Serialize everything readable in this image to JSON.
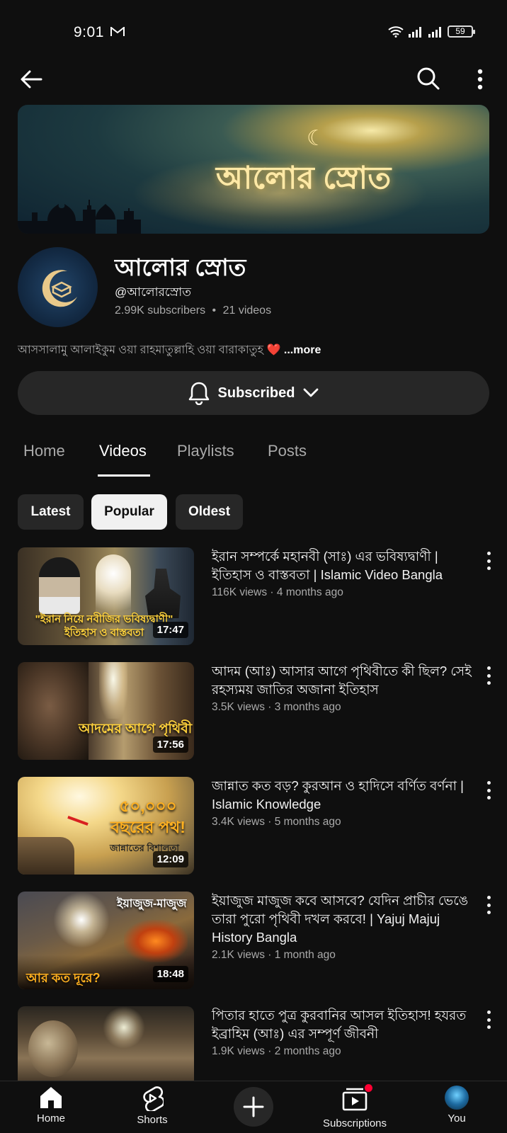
{
  "status_bar": {
    "time": "9:01",
    "battery": "59"
  },
  "channel": {
    "banner_title": "আলোর স্রোত",
    "name": "আলোর স্রোত",
    "handle": "@আলোরস্রোত",
    "subscribers": "2.99K subscribers",
    "videos_count": "21 videos",
    "meta_separator": "•",
    "description": "আসসালামু আলাইকুম ওয়া রাহমাতুল্লাহি ওয়া বারাকাতুহ",
    "description_emoji": "❤️",
    "more_label": "...more",
    "subscribe_label": "Subscribed"
  },
  "tabs": [
    {
      "label": "Home"
    },
    {
      "label": "Videos"
    },
    {
      "label": "Playlists"
    },
    {
      "label": "Posts"
    }
  ],
  "active_tab": "Videos",
  "sort_chips": [
    {
      "label": "Latest"
    },
    {
      "label": "Popular"
    },
    {
      "label": "Oldest"
    }
  ],
  "selected_chip": "Popular",
  "videos": [
    {
      "title": "ইরান সম্পর্কে মহানবী (সাঃ) এর ভবিষ্যদ্বাণী | ইতিহাস ও বাস্তবতা | Islamic Video Bangla",
      "meta": "116K views · 4 months ago",
      "duration": "17:47",
      "thumb_text": "\"ইরান নিয়ে নবীজির ভবিষ্যদ্বাণী\" ইতিহাস ও বাস্তবতা"
    },
    {
      "title": "আদম (আঃ) আসার আগে পৃথিবীতে কী ছিল? সেই রহস্যময় জাতির অজানা ইতিহাস",
      "meta": "3.5K views · 3 months ago",
      "duration": "17:56",
      "thumb_text": "আদমের আগে পৃথিবী"
    },
    {
      "title": "জান্নাত কত বড়? কুরআন ও হাদিসে বর্ণিত বর্ণনা | Islamic Knowledge",
      "meta": "3.4K views · 5 months ago",
      "duration": "12:09",
      "thumb_text": "৫০,০০০ বছরের পথ!",
      "thumb_subtext": "জান্নাতের বিশালতা"
    },
    {
      "title": "ইয়াজুজ মাজুজ কবে আসবে? যেদিন প্রাচীর ভেঙে তারা পুরো পৃথিবী দখল করবে! | Yajuj Majuj History Bangla",
      "meta": "2.1K views · 1 month ago",
      "duration": "18:48",
      "thumb_text": "ইয়াজুজ-মাজুজ",
      "thumb_subtext": "আর কত দূরে?"
    },
    {
      "title": "পিতার হাতে পুত্র কুরবানির আসল ইতিহাস! হযরত ইব্রাহিম (আঃ) এর সম্পূর্ণ জীবনী",
      "meta": "1.9K views · 2 months ago",
      "duration": "",
      "thumb_text": ""
    }
  ],
  "bottom_nav": [
    {
      "label": "Home",
      "icon": "home-icon"
    },
    {
      "label": "Shorts",
      "icon": "shorts-icon"
    },
    {
      "label": "",
      "icon": "create-icon"
    },
    {
      "label": "Subscriptions",
      "icon": "subscriptions-icon"
    },
    {
      "label": "You",
      "icon": "avatar"
    }
  ],
  "colors": {
    "background": "#0f0f0f",
    "surface": "#272727",
    "text": "#f1f1f1",
    "secondary": "#aaaaaa",
    "accent": "#ff0033"
  }
}
